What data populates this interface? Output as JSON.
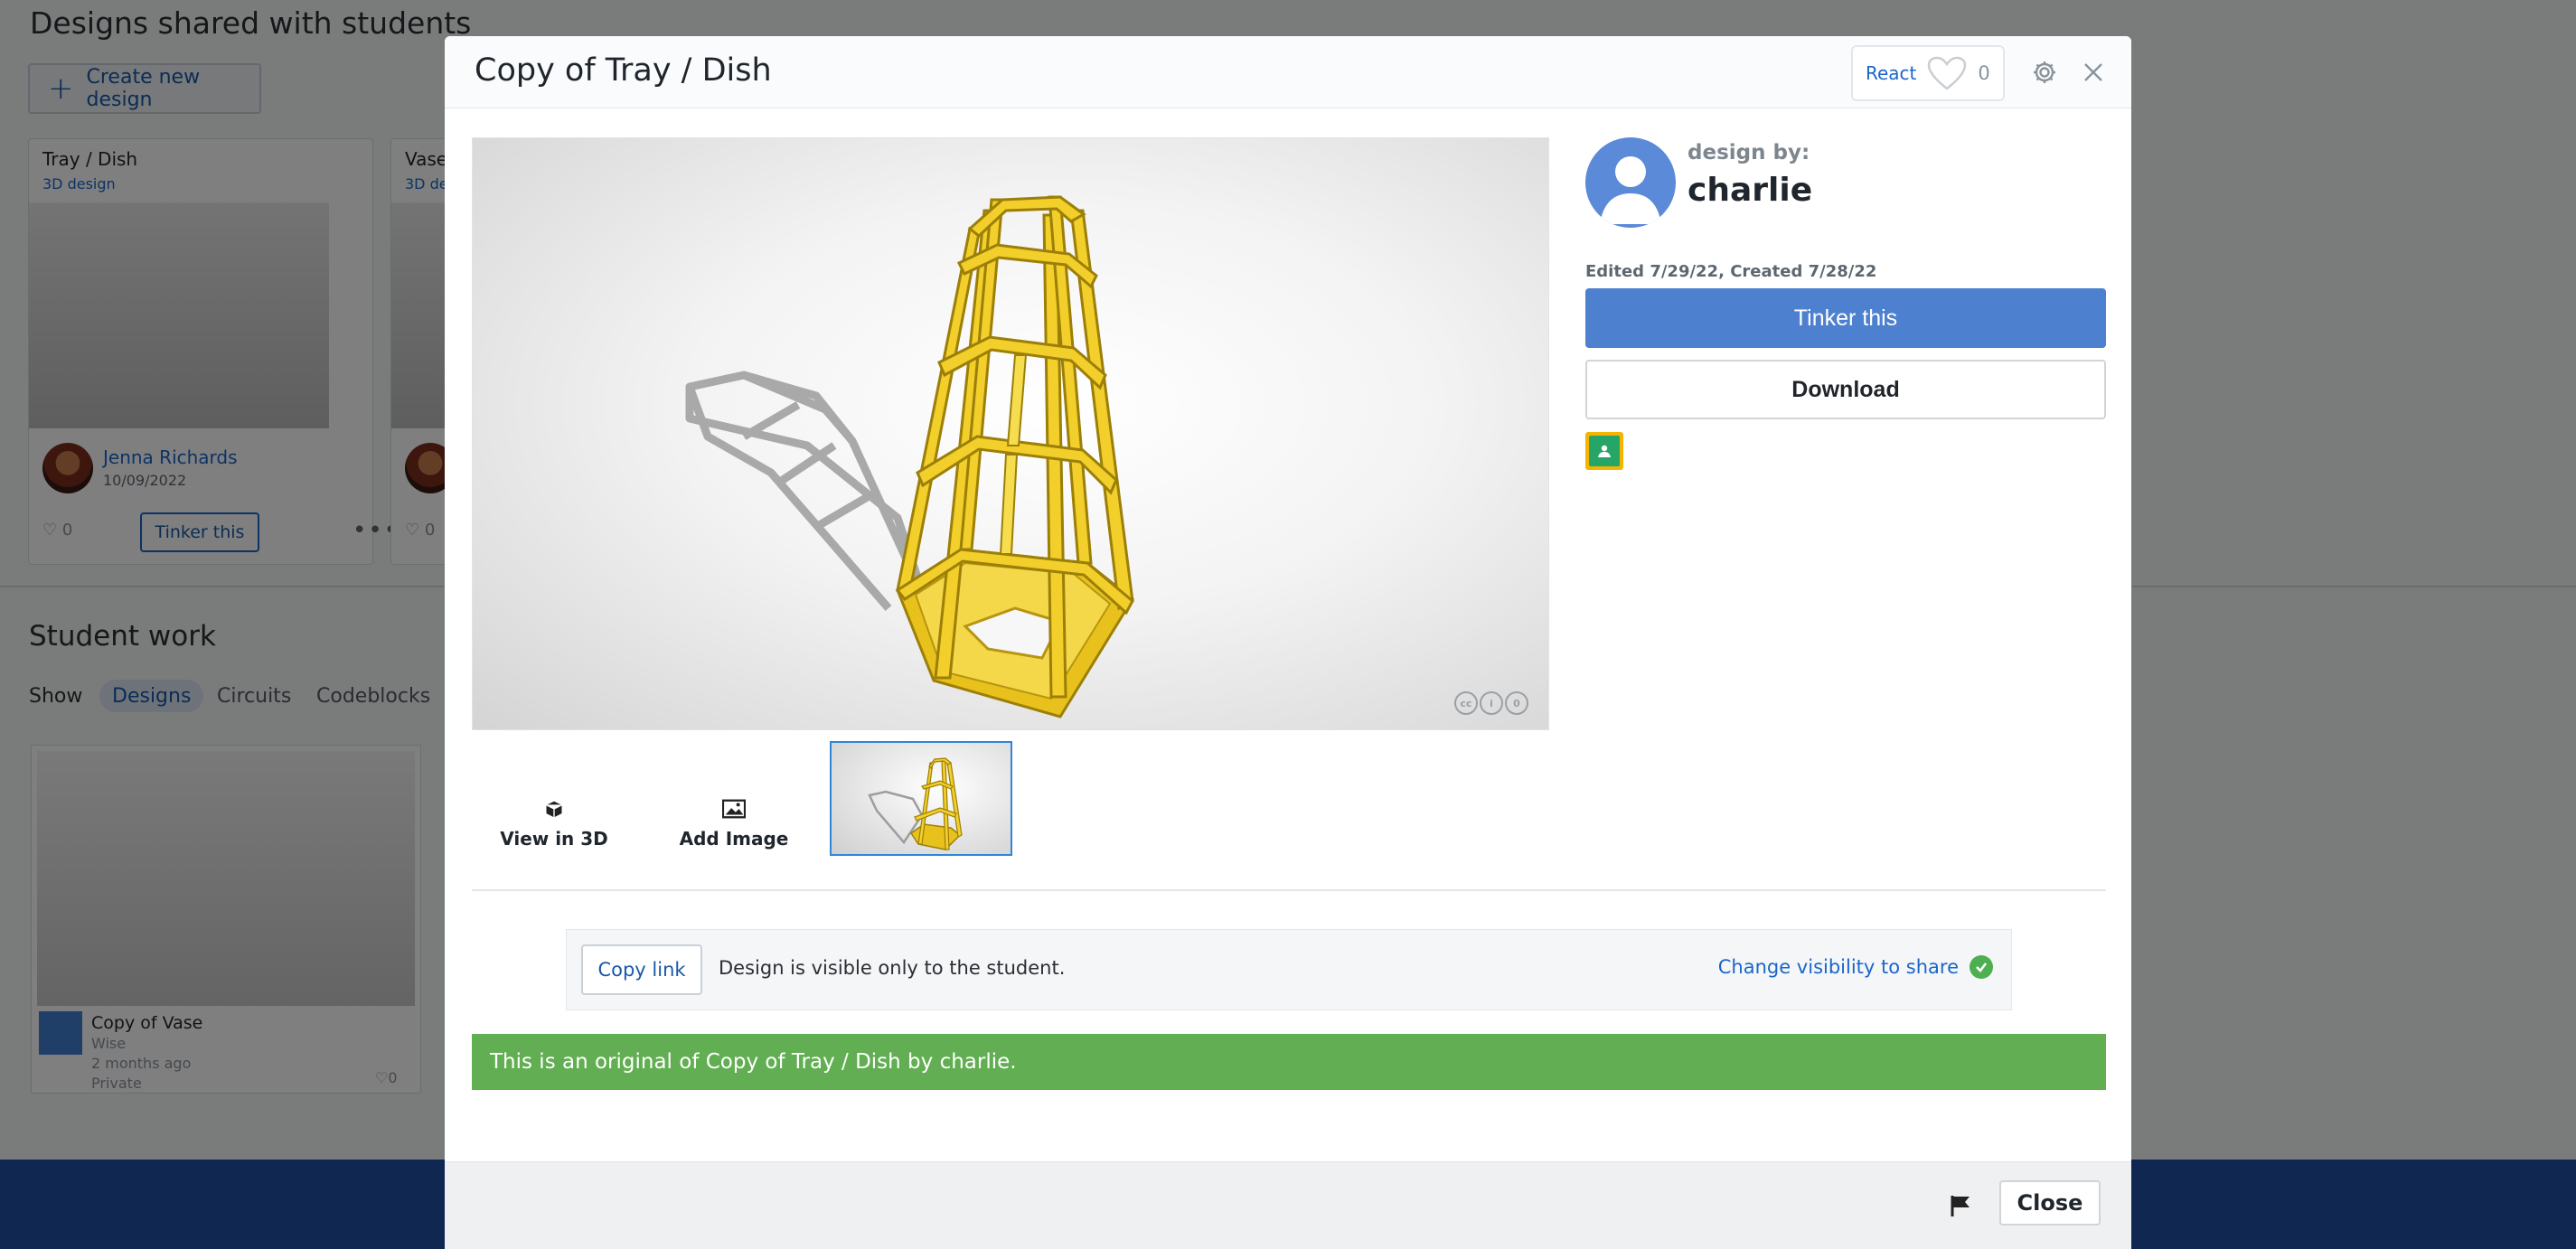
{
  "background": {
    "section_title": "Designs shared with students",
    "create_button": "Create new design",
    "cards": [
      {
        "title": "Tray / Dish",
        "subtitle": "3D design",
        "author": "Jenna Richards",
        "date": "10/09/2022",
        "likes": "0",
        "action": "Tinker this"
      },
      {
        "title": "Vase",
        "subtitle": "3D de",
        "likes": "0"
      }
    ],
    "student_work_title": "Student work",
    "show_label": "Show",
    "show_tabs": [
      "Designs",
      "Circuits",
      "Codeblocks"
    ],
    "student_card": {
      "name": "Copy of Vase",
      "owner": "Wise",
      "when": "2 months ago",
      "privacy": "Private",
      "likes": "0"
    }
  },
  "modal": {
    "title": "Copy of Tray / Dish",
    "react": {
      "label": "React",
      "count": "0"
    },
    "tools": {
      "view3d": "View in 3D",
      "add_image": "Add Image"
    },
    "author": {
      "label": "design by:",
      "name": "charlie"
    },
    "edited": "Edited 7/29/22, Created 7/28/22",
    "tinker_button": "Tinker this",
    "download_button": "Download",
    "share": {
      "copy_link": "Copy link",
      "visibility": "Design is visible only to the student.",
      "change": "Change visibility to share"
    },
    "banner": "This is an original of Copy of Tray / Dish by charlie.",
    "close_button": "Close",
    "icons": {
      "gear": "gear-icon",
      "close": "close-icon",
      "heart": "heart-icon",
      "cube": "cube-icon",
      "image": "image-icon",
      "flag": "flag-icon",
      "shield": "shield-check-icon",
      "classroom": "google-classroom-icon"
    },
    "colors": {
      "accent": "#4d80cf",
      "banner": "#62ae52",
      "link": "#1b66c9",
      "model": "#f2cf2a"
    }
  }
}
